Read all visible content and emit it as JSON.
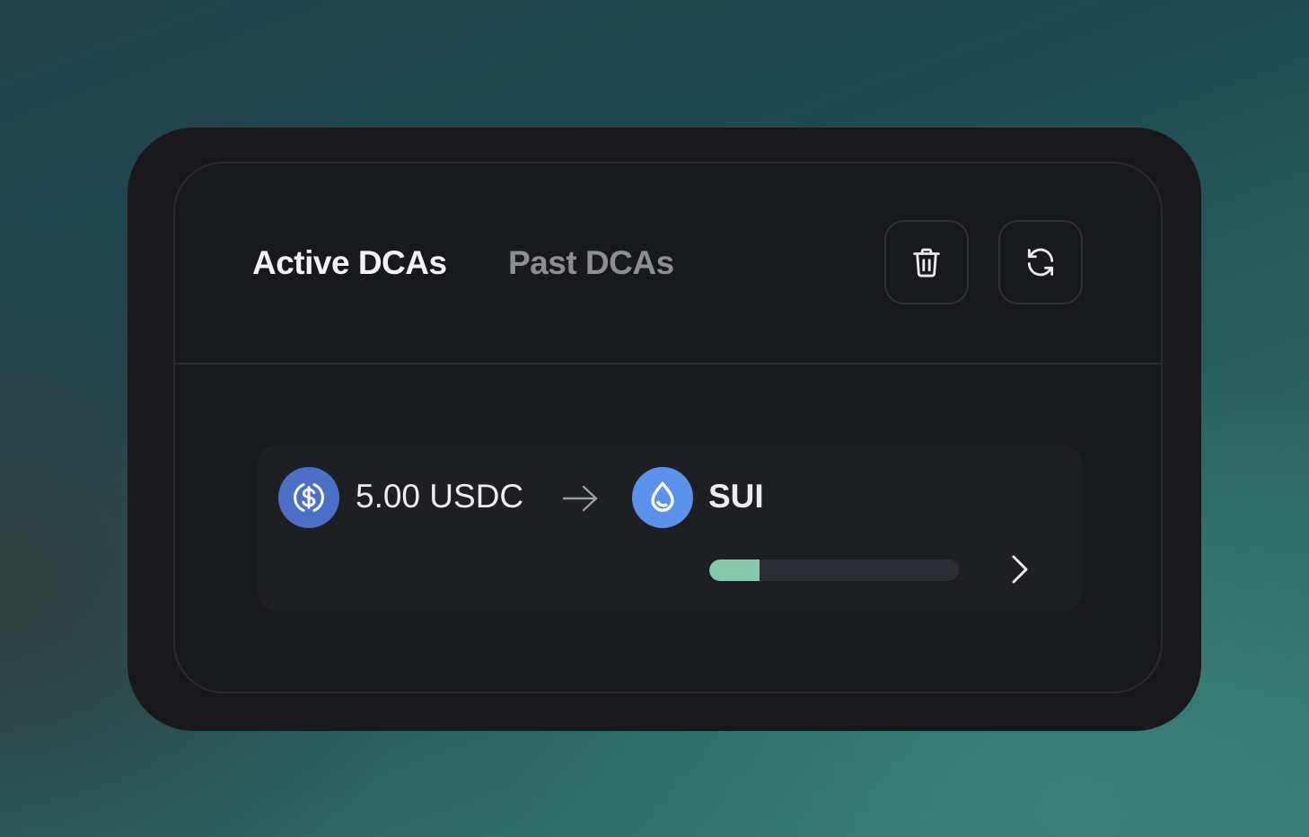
{
  "tabs": {
    "active_label": "Active DCAs",
    "past_label": "Past DCAs"
  },
  "actions": {
    "delete_icon": "trash-icon",
    "refresh_icon": "refresh-icon"
  },
  "dca": {
    "from_amount": "5.00 USDC",
    "from_token_icon": "usdc-icon",
    "arrow_icon": "arrow-right-icon",
    "to_token": "SUI",
    "to_token_icon": "sui-droplet-icon",
    "progress_fraction": 0.2,
    "open_icon": "chevron-right-icon"
  },
  "colors": {
    "card_bg": "#19191c",
    "row_bg": "#1e1f23",
    "usdc_blue": "#4d6fc7",
    "sui_blue": "#5b93ec",
    "progress_fill": "#84c9ab",
    "progress_track": "#2d2e33",
    "tab_active": "#f3f3f5",
    "tab_inactive": "#8d8e93"
  }
}
